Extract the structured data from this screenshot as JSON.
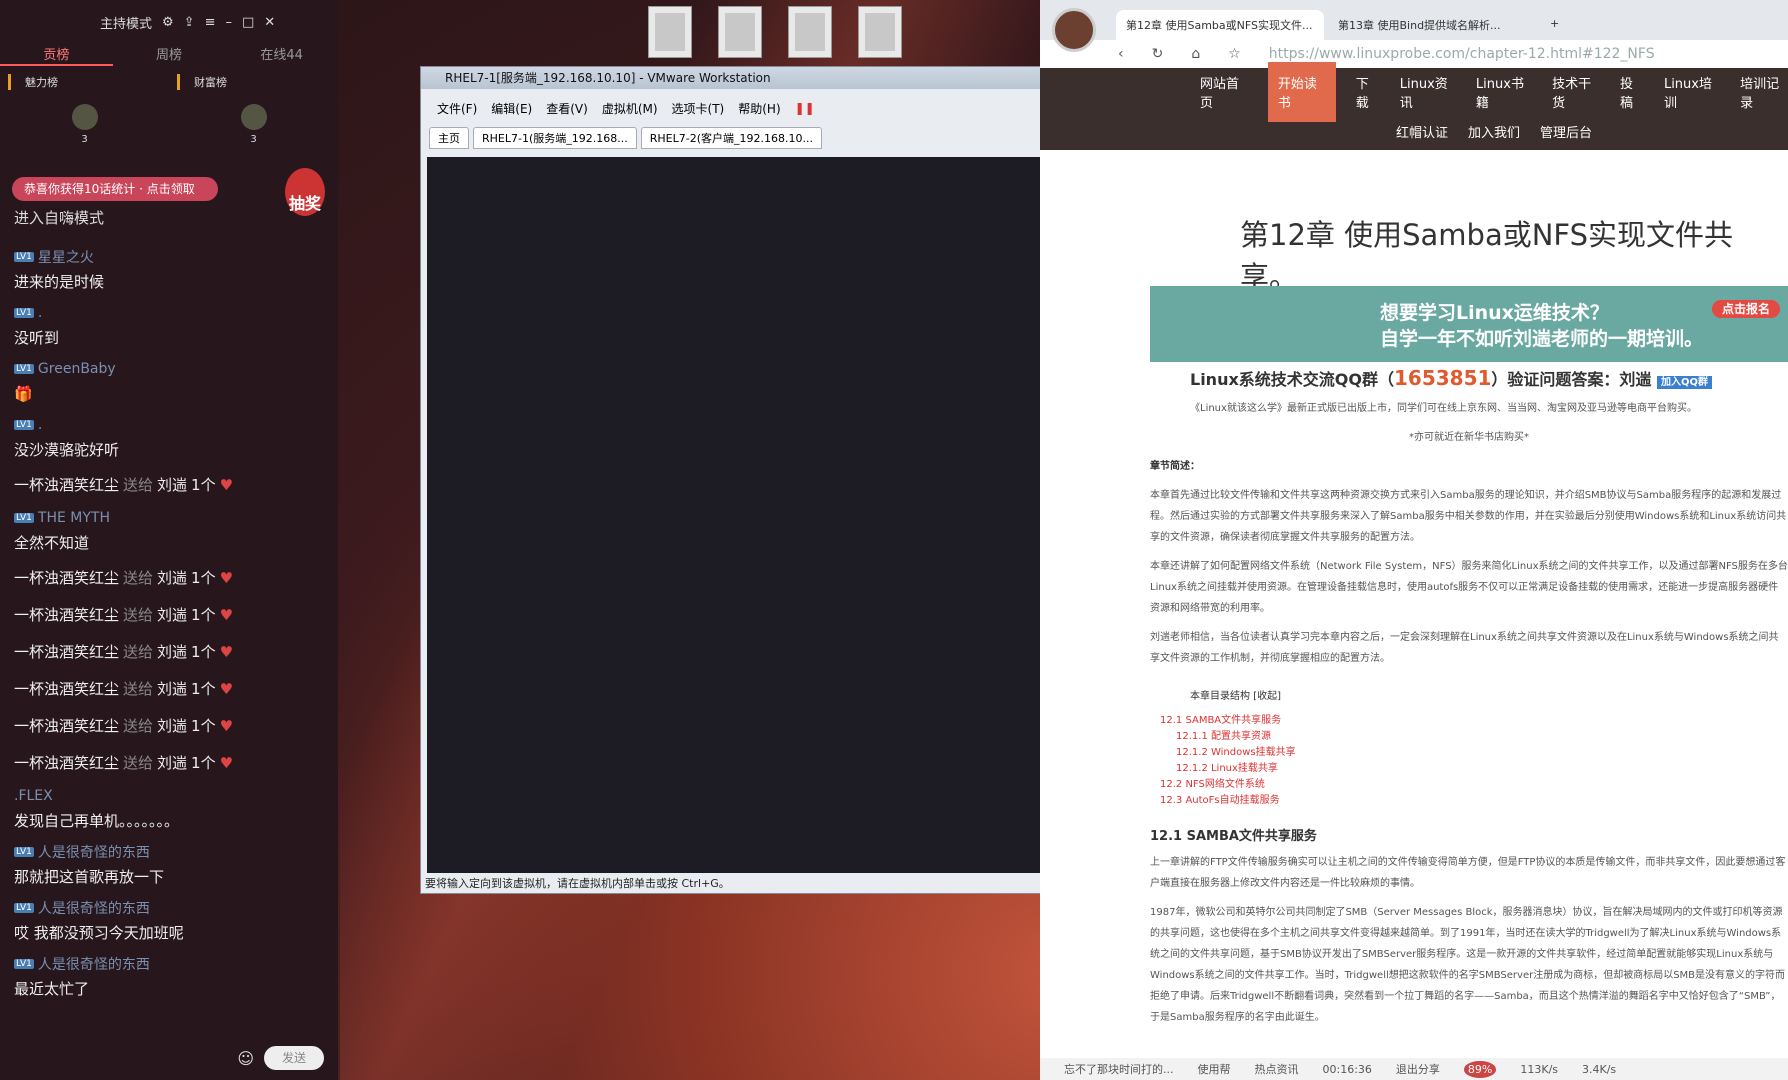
{
  "desktop": {
    "icon_count": 4
  },
  "live": {
    "title": "主持模式",
    "tabs": [
      "贡榜",
      "周榜",
      "在线44"
    ],
    "rank": [
      "魅力榜",
      "财富榜"
    ],
    "rank_counts": [
      "3",
      "3"
    ],
    "notice": "恭喜你获得10话统计 · 点击领取",
    "lottery": "抽奖",
    "mode": "进入自嗨模式",
    "messages": [
      {
        "user": "星星之火",
        "level": "LV1",
        "text": "进来的是时候"
      },
      {
        "user": ".",
        "level": "LV1",
        "text": "没听到"
      },
      {
        "user": "GreenBaby",
        "level": "LV1",
        "text": "🎁"
      },
      {
        "user": ".",
        "level": "LV1",
        "text": "没沙漠骆驼好听"
      }
    ],
    "gift": {
      "from": "一杯浊酒笑红尘",
      "verb": "送给",
      "to": "刘遄",
      "qty": "1个"
    },
    "messages2": [
      {
        "user": "THE MYTH",
        "level": "LV1",
        "text": "全然不知道"
      }
    ],
    "gift_repeat": 6,
    "messages3": [
      {
        "user": ".FLEX",
        "level": "",
        "text": "发现自己再单机。。。。。。。"
      },
      {
        "user": "人是很奇怪的东西",
        "level": "LV1",
        "text": "那就把这首歌再放一下"
      },
      {
        "user": "人是很奇怪的东西",
        "level": "LV1",
        "text": "哎 我都没预习今天加班呢"
      },
      {
        "user": "人是很奇怪的东西",
        "level": "LV1",
        "text": "最近太忙了"
      }
    ],
    "send": "发送"
  },
  "vm": {
    "title": "RHEL7-1[服务端_192.168.10.10] - VMware Workstation",
    "menu": [
      "文件(F)",
      "编辑(E)",
      "查看(V)",
      "虚拟机(M)",
      "选项卡(T)",
      "帮助(H)"
    ],
    "tabs": [
      "主页",
      "RHEL7-1(服务端_192.168...",
      "RHEL7-2(客户端_192.168.10..."
    ],
    "status": "要将输入定向到该虚拟机，请在虚拟机内部单击或按 Ctrl+G。"
  },
  "browser": {
    "tabs": [
      "第12章 使用Samba或NFS实现文件...",
      "第13章 使用Bind提供域名解析..."
    ],
    "url": "https://www.linuxprobe.com/chapter-12.html#122_NFS",
    "nav1": [
      "网站首页",
      "开始读书",
      "下载",
      "Linux资讯",
      "Linux书籍",
      "技术干货",
      "投稿",
      "Linux培训",
      "培训记录"
    ],
    "nav2": [
      "红帽认证",
      "加入我们",
      "管理后台"
    ],
    "h1": "第12章 使用Samba或NFS实现文件共享。",
    "banner1": "想要学习Linux运维技术？",
    "banner2": "自学一年不如听刘遄老师的一期培训。",
    "banner_btn": "点击报名",
    "qq_pre": "Linux系统技术交流QQ群（",
    "qq_num": "1653851",
    "qq_post": "）验证问题答案：刘遄",
    "qq_btn": "加入QQ群",
    "book": "《Linux就该这么学》最新正式版已出版上市，同学们可在线上京东网、当当网、淘宝网及亚马逊等电商平台购买。",
    "store": "*亦可就近在新华书店购买*",
    "summary_h": "章节简述：",
    "para1": "本章首先通过比较文件传输和文件共享这两种资源交换方式来引入Samba服务的理论知识，并介绍SMB协议与Samba服务程序的起源和发展过程。然后通过实验的方式部署文件共享服务来深入了解Samba服务中相关参数的作用，并在实验最后分别使用Windows系统和Linux系统访问共享的文件资源，确保读者彻底掌握文件共享服务的配置方法。",
    "para2": "本章还讲解了如何配置网络文件系统（Network File System，NFS）服务来简化Linux系统之间的文件共享工作，以及通过部署NFS服务在多台Linux系统之间挂载并使用资源。在管理设备挂载信息时，使用autofs服务不仅可以正常满足设备挂载的使用需求，还能进一步提高服务器硬件资源和网络带宽的利用率。",
    "para3": "刘遄老师相信，当各位读者认真学习完本章内容之后，一定会深刻理解在Linux系统之间共享文件资源以及在Linux系统与Windows系统之间共享文件资源的工作机制，并彻底掌握相应的配置方法。",
    "toc_h": "本章目录结构 [收起]",
    "toc": [
      "12.1 SAMBA文件共享服务",
      "12.1.1 配置共享资源",
      "12.1.2 Windows挂载共享",
      "12.1.2 Linux挂载共享",
      "12.2 NFS网络文件系统",
      "12.3 AutoFs自动挂载服务"
    ],
    "sec": "12.1 SAMBA文件共享服务",
    "para4": "上一章讲解的FTP文件传输服务确实可以让主机之间的文件传输变得简单方便，但是FTP协议的本质是传输文件，而非共享文件，因此要想通过客户端直接在服务器上修改文件内容还是一件比较麻烦的事情。",
    "para5": "1987年，微软公司和英特尔公司共同制定了SMB（Server Messages Block，服务器消息块）协议，旨在解决局域网内的文件或打印机等资源的共享问题，这也使得在多个主机之间共享文件变得越来越简单。到了1991年，当时还在读大学的Tridgwell为了解决Linux系统与Windows系统之间的文件共享问题，基于SMB协议开发出了SMBServer服务程序。这是一款开源的文件共享软件，经过简单配置就能够实现Linux系统与Windows系统之间的文件共享工作。当时，Tridgwell想把这款软件的名字SMBServer注册成为商标，但却被商标局以SMB是没有意义的字符而拒绝了申请。后来Tridgwell不断翻看词典，突然看到一个拉丁舞蹈的名字——Samba，而且这个热情洋溢的舞蹈名字中又恰好包含了“SMB”，于是Samba服务程序的名字由此诞生。",
    "bottom": [
      "忘不了那块时间打的...",
      "使用帮",
      "热点资讯"
    ],
    "time": "00:16:36",
    "exit": "退出分享",
    "cpu": "89%",
    "net_up": "113K/s",
    "net_down": "3.4K/s"
  }
}
